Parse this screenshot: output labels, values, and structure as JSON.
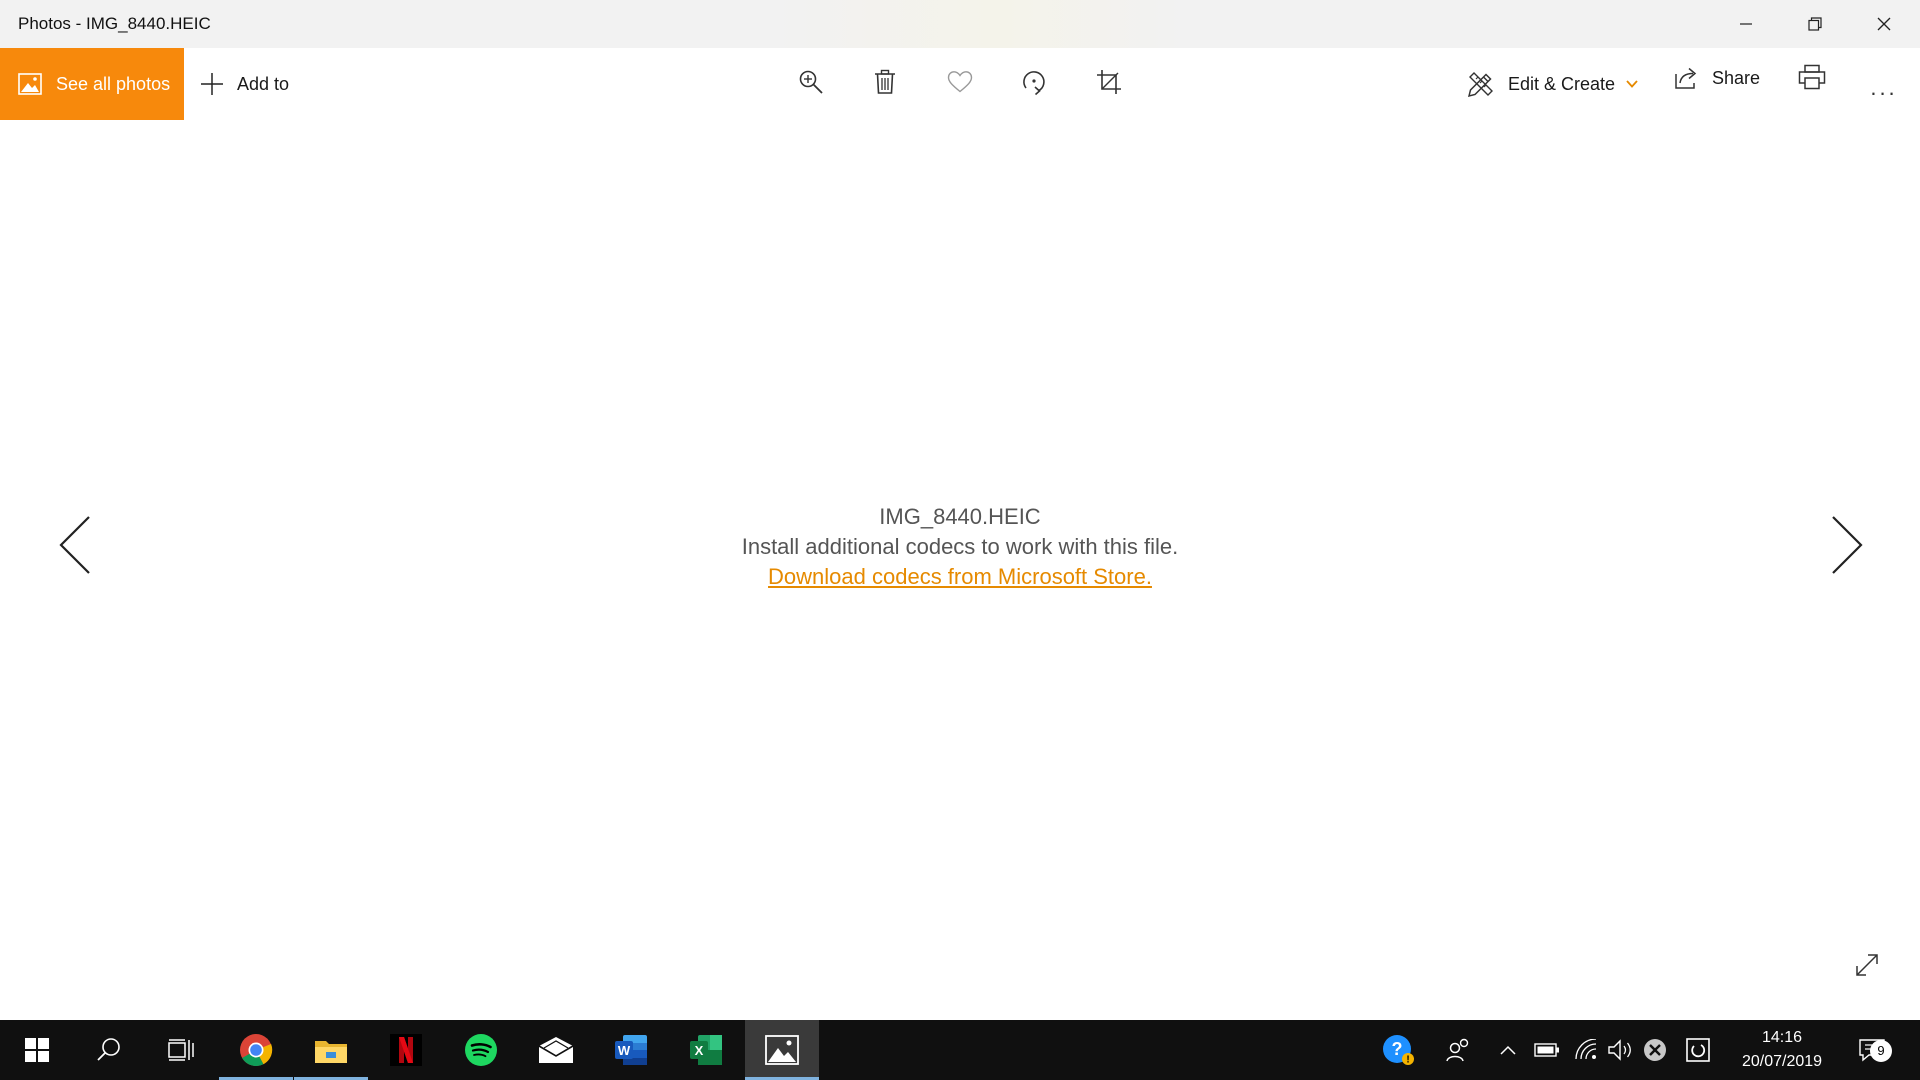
{
  "window": {
    "title": "Photos - IMG_8440.HEIC"
  },
  "toolbar": {
    "see_all_label": "See all photos",
    "add_to_label": "Add to",
    "edit_create_label": "Edit & Create",
    "share_label": "Share",
    "more_label": "..."
  },
  "message": {
    "filename": "IMG_8440.HEIC",
    "description": "Install additional codecs to work with this file.",
    "link": "Download codecs from Microsoft Store."
  },
  "taskbar": {
    "time": "14:16",
    "date": "20/07/2019",
    "notification_count": "9"
  },
  "colors": {
    "accent": "#f7890c",
    "link": "#e68a00",
    "taskbar": "#101010"
  }
}
